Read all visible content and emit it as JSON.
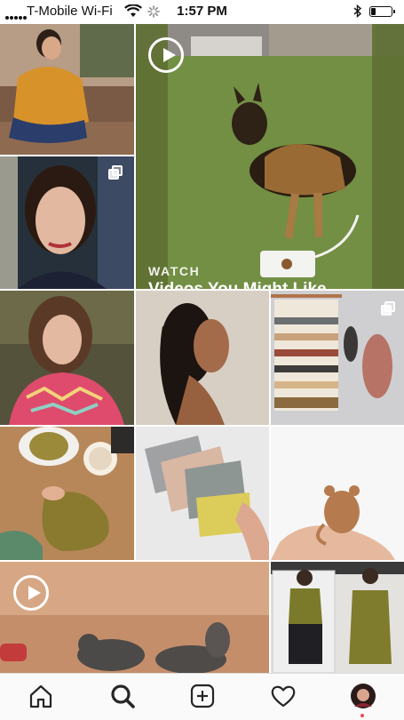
{
  "status_bar": {
    "carrier": "T-Mobile Wi-Fi",
    "time": "1:57 PM",
    "battery_level": 0.25
  },
  "grid": {
    "featured_video": {
      "kicker": "WATCH",
      "title": "Videos You Might Like"
    },
    "tiles": [
      {
        "subject": "woman in mustard knit sweater sitting on floor",
        "type": "photo"
      },
      {
        "subject": "video of German shepherd sniffing a paw-print device on a lawn",
        "type": "video"
      },
      {
        "subject": "portrait of a smiling woman",
        "type": "carousel"
      },
      {
        "subject": "woman in pink fair-isle sweater selfie",
        "type": "photo"
      },
      {
        "subject": "woman with long braids in profile",
        "type": "photo"
      },
      {
        "subject": "woven wall hanging with yarn skeins",
        "type": "carousel"
      },
      {
        "subject": "knitting project with yarn and coffee cup",
        "type": "photo"
      },
      {
        "subject": "hand holding zipper pouches",
        "type": "photo"
      },
      {
        "subject": "hand holding small leather bear keychain",
        "type": "photo"
      },
      {
        "subject": "video of kittens",
        "type": "video"
      },
      {
        "subject": "mirror selfies in olive knit tank tops",
        "type": "photo"
      }
    ]
  },
  "nav": {
    "icons": [
      "home-icon",
      "search-icon",
      "new-post-icon",
      "activity-heart-icon",
      "profile-avatar"
    ]
  },
  "colors": {
    "accent_notification": "#ed4956",
    "nav_background": "#fafafa"
  }
}
